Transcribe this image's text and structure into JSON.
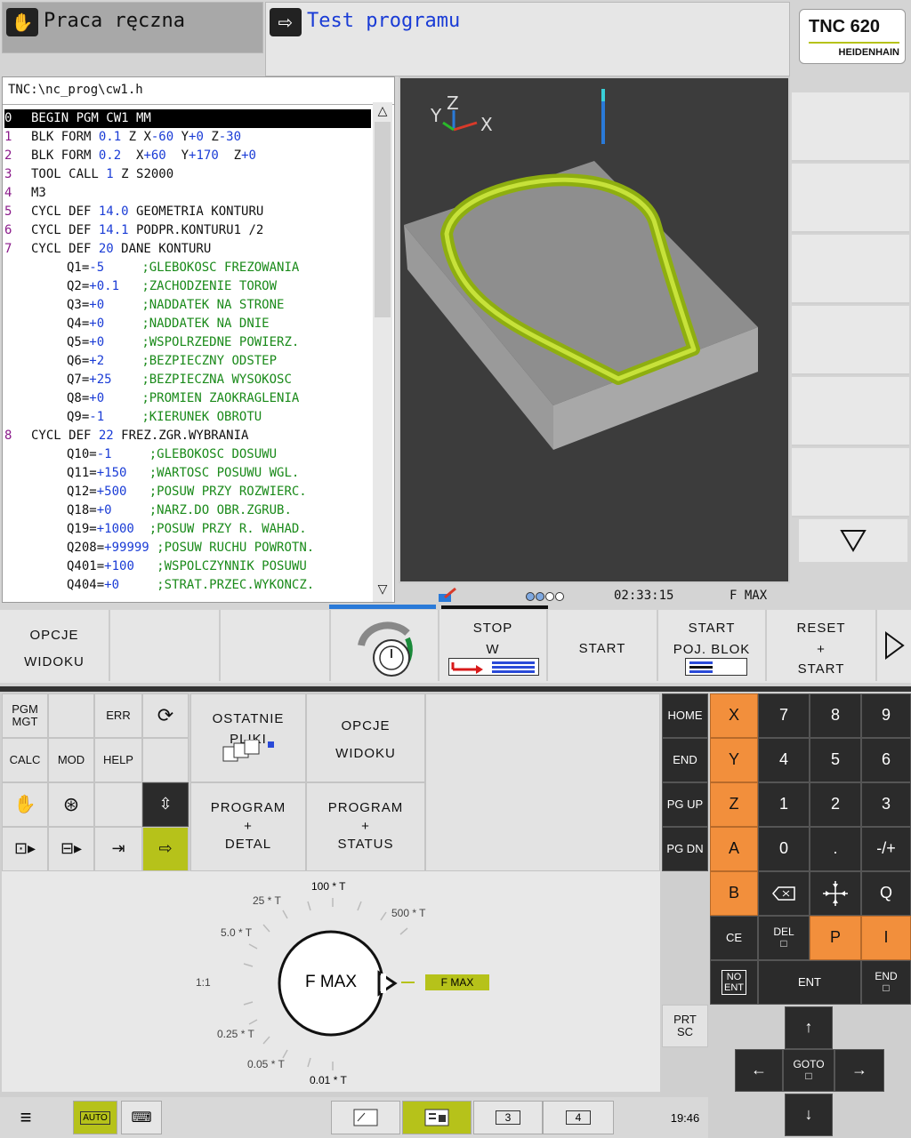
{
  "header": {
    "manual_mode": "Praca ręczna",
    "test_mode": "Test programu",
    "logo_model": "TNC 620",
    "logo_brand": "HEIDENHAIN"
  },
  "program": {
    "path": "TNC:\\nc_prog\\cw1.h",
    "lines": [
      {
        "n": "0",
        "text": "BEGIN PGM CW1 MM"
      },
      {
        "n": "1",
        "text": "BLK FORM 0.1 Z X-60 Y+0 Z-30"
      },
      {
        "n": "2",
        "text": "BLK FORM 0.2  X+60  Y+170  Z+0"
      },
      {
        "n": "3",
        "text": "TOOL CALL 1 Z S2000"
      },
      {
        "n": "4",
        "text": "M3"
      },
      {
        "n": "5",
        "text": "CYCL DEF 14.0 GEOMETRIA KONTURU"
      },
      {
        "n": "6",
        "text": "CYCL DEF 14.1 PODPR.KONTURU1 /2"
      },
      {
        "n": "7",
        "text": "CYCL DEF 20 DANE KONTURU"
      },
      {
        "n": "",
        "text": "Q1=-5     ;GLEBOKOSC FREZOWANIA"
      },
      {
        "n": "",
        "text": "Q2=+0.1   ;ZACHODZENIE TOROW"
      },
      {
        "n": "",
        "text": "Q3=+0     ;NADDATEK NA STRONE"
      },
      {
        "n": "",
        "text": "Q4=+0     ;NADDATEK NA DNIE"
      },
      {
        "n": "",
        "text": "Q5=+0     ;WSPOLRZEDNE POWIERZ."
      },
      {
        "n": "",
        "text": "Q6=+2     ;BEZPIECZNY ODSTEP"
      },
      {
        "n": "",
        "text": "Q7=+25    ;BEZPIECZNA WYSOKOSC"
      },
      {
        "n": "",
        "text": "Q8=+0     ;PROMIEN ZAOKRAGLENIA"
      },
      {
        "n": "",
        "text": "Q9=-1     ;KIERUNEK OBROTU"
      },
      {
        "n": "8",
        "text": "CYCL DEF 22 FREZ.ZGR.WYBRANIA"
      },
      {
        "n": "",
        "text": "Q10=-1     ;GLEBOKOSC DOSUWU"
      },
      {
        "n": "",
        "text": "Q11=+150   ;WARTOSC POSUWU WGL."
      },
      {
        "n": "",
        "text": "Q12=+500   ;POSUW PRZY ROZWIERC."
      },
      {
        "n": "",
        "text": "Q18=+0     ;NARZ.DO OBR.ZGRUB."
      },
      {
        "n": "",
        "text": "Q19=+1000  ;POSUW PRZY R. WAHAD."
      },
      {
        "n": "",
        "text": "Q208=+99999 ;POSUW RUCHU POWROTN."
      },
      {
        "n": "",
        "text": "Q401=+100   ;WSPOLCZYNNIK POSUWU"
      },
      {
        "n": "",
        "text": "Q404=+0     ;STRAT.PRZEC.WYKONCZ."
      }
    ]
  },
  "view3d": {
    "axis_x": "X",
    "axis_y": "Y",
    "axis_z": "Z"
  },
  "status": {
    "time": "02:33:15",
    "feed": "F MAX"
  },
  "softkeys": {
    "view_options": [
      "OPCJE",
      "WIDOKU"
    ],
    "stop": [
      "STOP",
      "W"
    ],
    "start": "START",
    "start_single": [
      "START",
      "POJ. BLOK"
    ],
    "reset_start": [
      "RESET",
      "+",
      "START"
    ]
  },
  "keyboard": {
    "pgm_mgt": [
      "PGM",
      "MGT"
    ],
    "err": "ERR",
    "calc": "CALC",
    "mod": "MOD",
    "help": "HELP",
    "recent_files": [
      "OSTATNIE",
      "PLIKI"
    ],
    "view_options": [
      "OPCJE",
      "WIDOKU"
    ],
    "prog_detail": [
      "PROGRAM",
      "+",
      "DETAL"
    ],
    "prog_status": [
      "PROGRAM",
      "+",
      "STATUS"
    ],
    "nav_keys": [
      "HOME",
      "END",
      "PG UP",
      "PG DN"
    ],
    "axis_keys": [
      "X",
      "Y",
      "Z",
      "A",
      "B"
    ],
    "digits": [
      "7",
      "8",
      "9",
      "4",
      "5",
      "6",
      "1",
      "2",
      "3",
      "0",
      ".",
      "-/+"
    ],
    "q": "Q",
    "ce": "CE",
    "del": "DEL",
    "p": "P",
    "i": "I",
    "no_ent": [
      "NO",
      "ENT"
    ],
    "ent": "ENT",
    "end": "END",
    "prt_sc": [
      "PRT",
      "SC"
    ],
    "goto": "GOTO"
  },
  "feed_dial": {
    "center": "F MAX",
    "value": "F MAX",
    "scale": [
      "100 * T",
      "25 * T",
      "500 * T",
      "5.0 * T",
      "1:1",
      "0.25 * T",
      "0.05 * T",
      "0.01 * T"
    ]
  },
  "taskbar": {
    "auto": "AUTO",
    "desk3": "3",
    "desk4": "4",
    "clock": "19:46"
  },
  "colors": {
    "accent_lime": "#b6c21a",
    "axis_orange": "#f28f3c",
    "program_blue": "#1a3cd6",
    "comment_green": "#1a8a1a",
    "line_number": "#8a1a8a"
  }
}
